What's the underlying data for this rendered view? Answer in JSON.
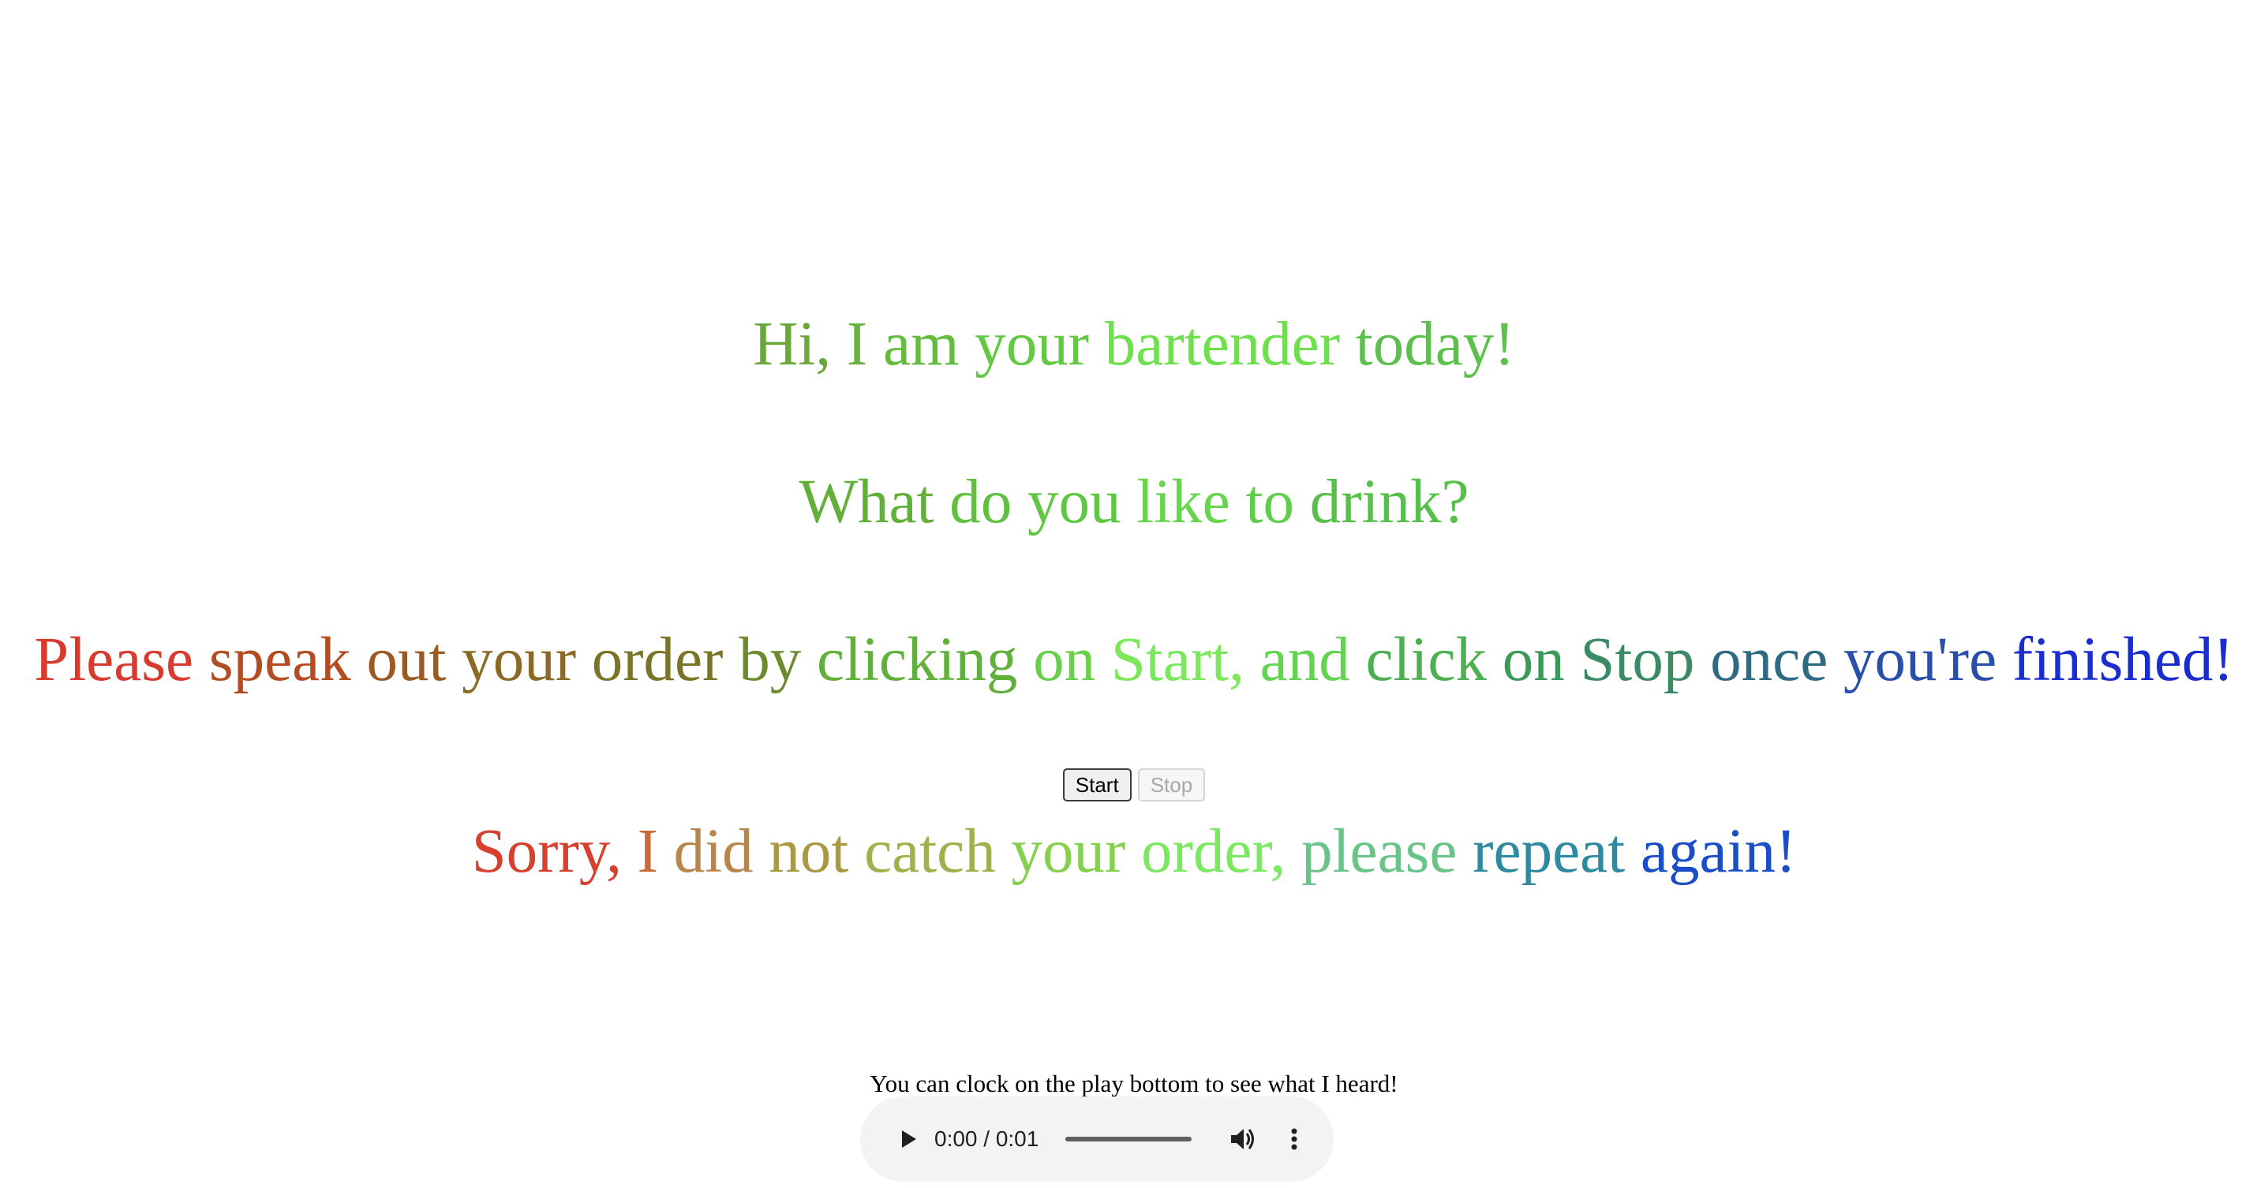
{
  "greeting": {
    "words": [
      {
        "text": "Hi,",
        "color": "#6aa83a"
      },
      {
        "text": "I",
        "color": "#67b23c"
      },
      {
        "text": "am",
        "color": "#64bb3e"
      },
      {
        "text": "your",
        "color": "#63c842"
      },
      {
        "text": "bartender",
        "color": "#6ee04d"
      },
      {
        "text": "today!",
        "color": "#5ec04c"
      }
    ]
  },
  "question": {
    "words": [
      {
        "text": "What",
        "color": "#62b03a"
      },
      {
        "text": "do",
        "color": "#60c040"
      },
      {
        "text": "you",
        "color": "#5fc843"
      },
      {
        "text": "like",
        "color": "#66d64b"
      },
      {
        "text": "to",
        "color": "#5fce4a"
      },
      {
        "text": "drink?",
        "color": "#57c04a"
      }
    ]
  },
  "instructions": {
    "words": [
      {
        "text": "Please",
        "color": "#d83a2e"
      },
      {
        "text": "speak",
        "color": "#b44c22"
      },
      {
        "text": "out",
        "color": "#9a5a22"
      },
      {
        "text": "your",
        "color": "#8a6a24"
      },
      {
        "text": "order",
        "color": "#7a7428"
      },
      {
        "text": "by",
        "color": "#6c8a2e"
      },
      {
        "text": "clicking",
        "color": "#62b03c"
      },
      {
        "text": "on",
        "color": "#6ad04c"
      },
      {
        "text": "Start,",
        "color": "#7ae85a"
      },
      {
        "text": "and",
        "color": "#62d450"
      },
      {
        "text": "click",
        "color": "#4cb050"
      },
      {
        "text": "on",
        "color": "#3c9a58"
      },
      {
        "text": "Stop",
        "color": "#3a8a66"
      },
      {
        "text": "once",
        "color": "#2e6a84"
      },
      {
        "text": "you're",
        "color": "#2850a8"
      },
      {
        "text": "finished!",
        "color": "#1a2ed0"
      }
    ]
  },
  "controls": {
    "start_label": "Start",
    "stop_label": "Stop"
  },
  "sorry": {
    "words": [
      {
        "text": "Sorry,",
        "color": "#d8402e"
      },
      {
        "text": "I",
        "color": "#c86a3a"
      },
      {
        "text": "did",
        "color": "#b8864a"
      },
      {
        "text": "not",
        "color": "#a89a42"
      },
      {
        "text": "catch",
        "color": "#9cb24a"
      },
      {
        "text": "your",
        "color": "#86d050"
      },
      {
        "text": "order,",
        "color": "#7ae860"
      },
      {
        "text": "please",
        "color": "#6ac48a"
      },
      {
        "text": "repeat",
        "color": "#2e8aa0"
      },
      {
        "text": "again!",
        "color": "#1a4ec8"
      }
    ]
  },
  "hint": "You can clock on the play bottom to see what I heard!",
  "audio_player": {
    "time_display": "0:00 / 0:01",
    "play_icon": "play-icon",
    "volume_icon": "volume-icon",
    "more_icon": "more-vertical-icon"
  }
}
